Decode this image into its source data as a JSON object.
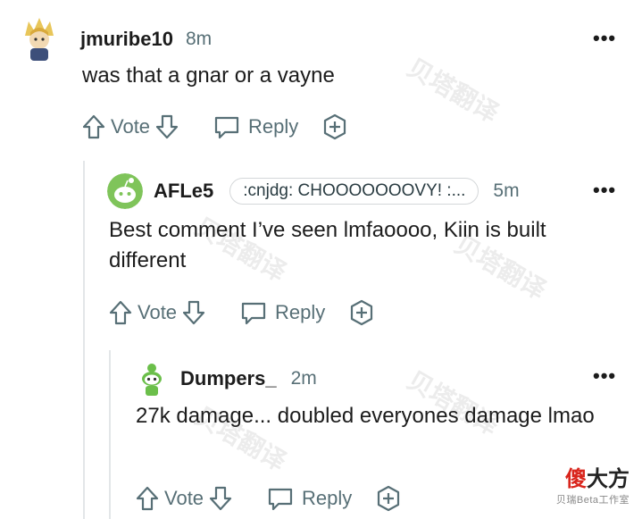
{
  "comments": [
    {
      "username": "jmuribe10",
      "time": "8m",
      "flair": "",
      "text": "was that a gnar or a vayne",
      "vote_label": "Vote",
      "reply_label": "Reply"
    },
    {
      "username": "AFLe5",
      "time": "5m",
      "flair": ":cnjdg: CHOOOOOOOVY! :...",
      "text": "Best comment I’ve seen lmfaoooo, Kiin is built different",
      "vote_label": "Vote",
      "reply_label": "Reply"
    },
    {
      "username": "Dumpers_",
      "time": "2m",
      "flair": "",
      "text": "27k damage... doubled everyones damage lmao",
      "vote_label": "Vote",
      "reply_label": "Reply"
    }
  ],
  "more_label": "•••",
  "watermark": "贝塔翻译",
  "brand": {
    "red": "傻",
    "main": "大方",
    "sub": "贝瑞Beta工作室"
  },
  "colors": {
    "text": "#1c1c1c",
    "meta": "#576f76",
    "thread_line": "#e3e6e8",
    "brand_red": "#d9251c"
  }
}
